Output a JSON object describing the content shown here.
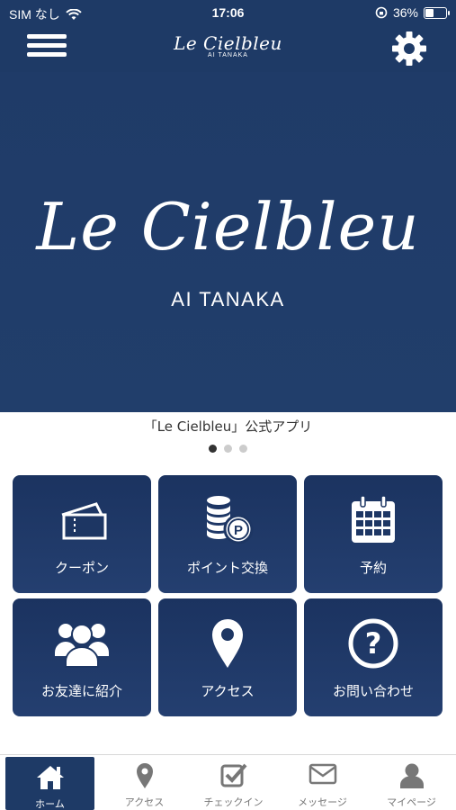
{
  "status": {
    "carrier": "SIM なし",
    "time": "17:06",
    "battery_text": "36%",
    "battery_level": 0.36
  },
  "header": {
    "logo_script": "Le Cielbleu",
    "logo_sub": "AI TANAKA"
  },
  "hero": {
    "script": "Le Cielbleu",
    "subtitle": "AI TANAKA",
    "caption": "「Le Cielbleu」公式アプリ",
    "slide_count": 3,
    "active_slide": 1
  },
  "tiles": [
    {
      "label": "クーポン",
      "icon": "ticket-icon"
    },
    {
      "label": "ポイント交換",
      "icon": "coins-icon"
    },
    {
      "label": "予約",
      "icon": "calendar-icon"
    },
    {
      "label": "お友達に紹介",
      "icon": "group-icon"
    },
    {
      "label": "アクセス",
      "icon": "map-pin-icon"
    },
    {
      "label": "お問い合わせ",
      "icon": "question-icon"
    }
  ],
  "tabbar": [
    {
      "label": "ホーム",
      "icon": "home-icon",
      "active": true
    },
    {
      "label": "アクセス",
      "icon": "map-pin-icon"
    },
    {
      "label": "チェックイン",
      "icon": "checkbox-icon"
    },
    {
      "label": "メッセージ",
      "icon": "envelope-icon"
    },
    {
      "label": "マイページ",
      "icon": "person-icon"
    }
  ],
  "colors": {
    "navy": "#1e3a66",
    "tile": "#1b3360"
  }
}
